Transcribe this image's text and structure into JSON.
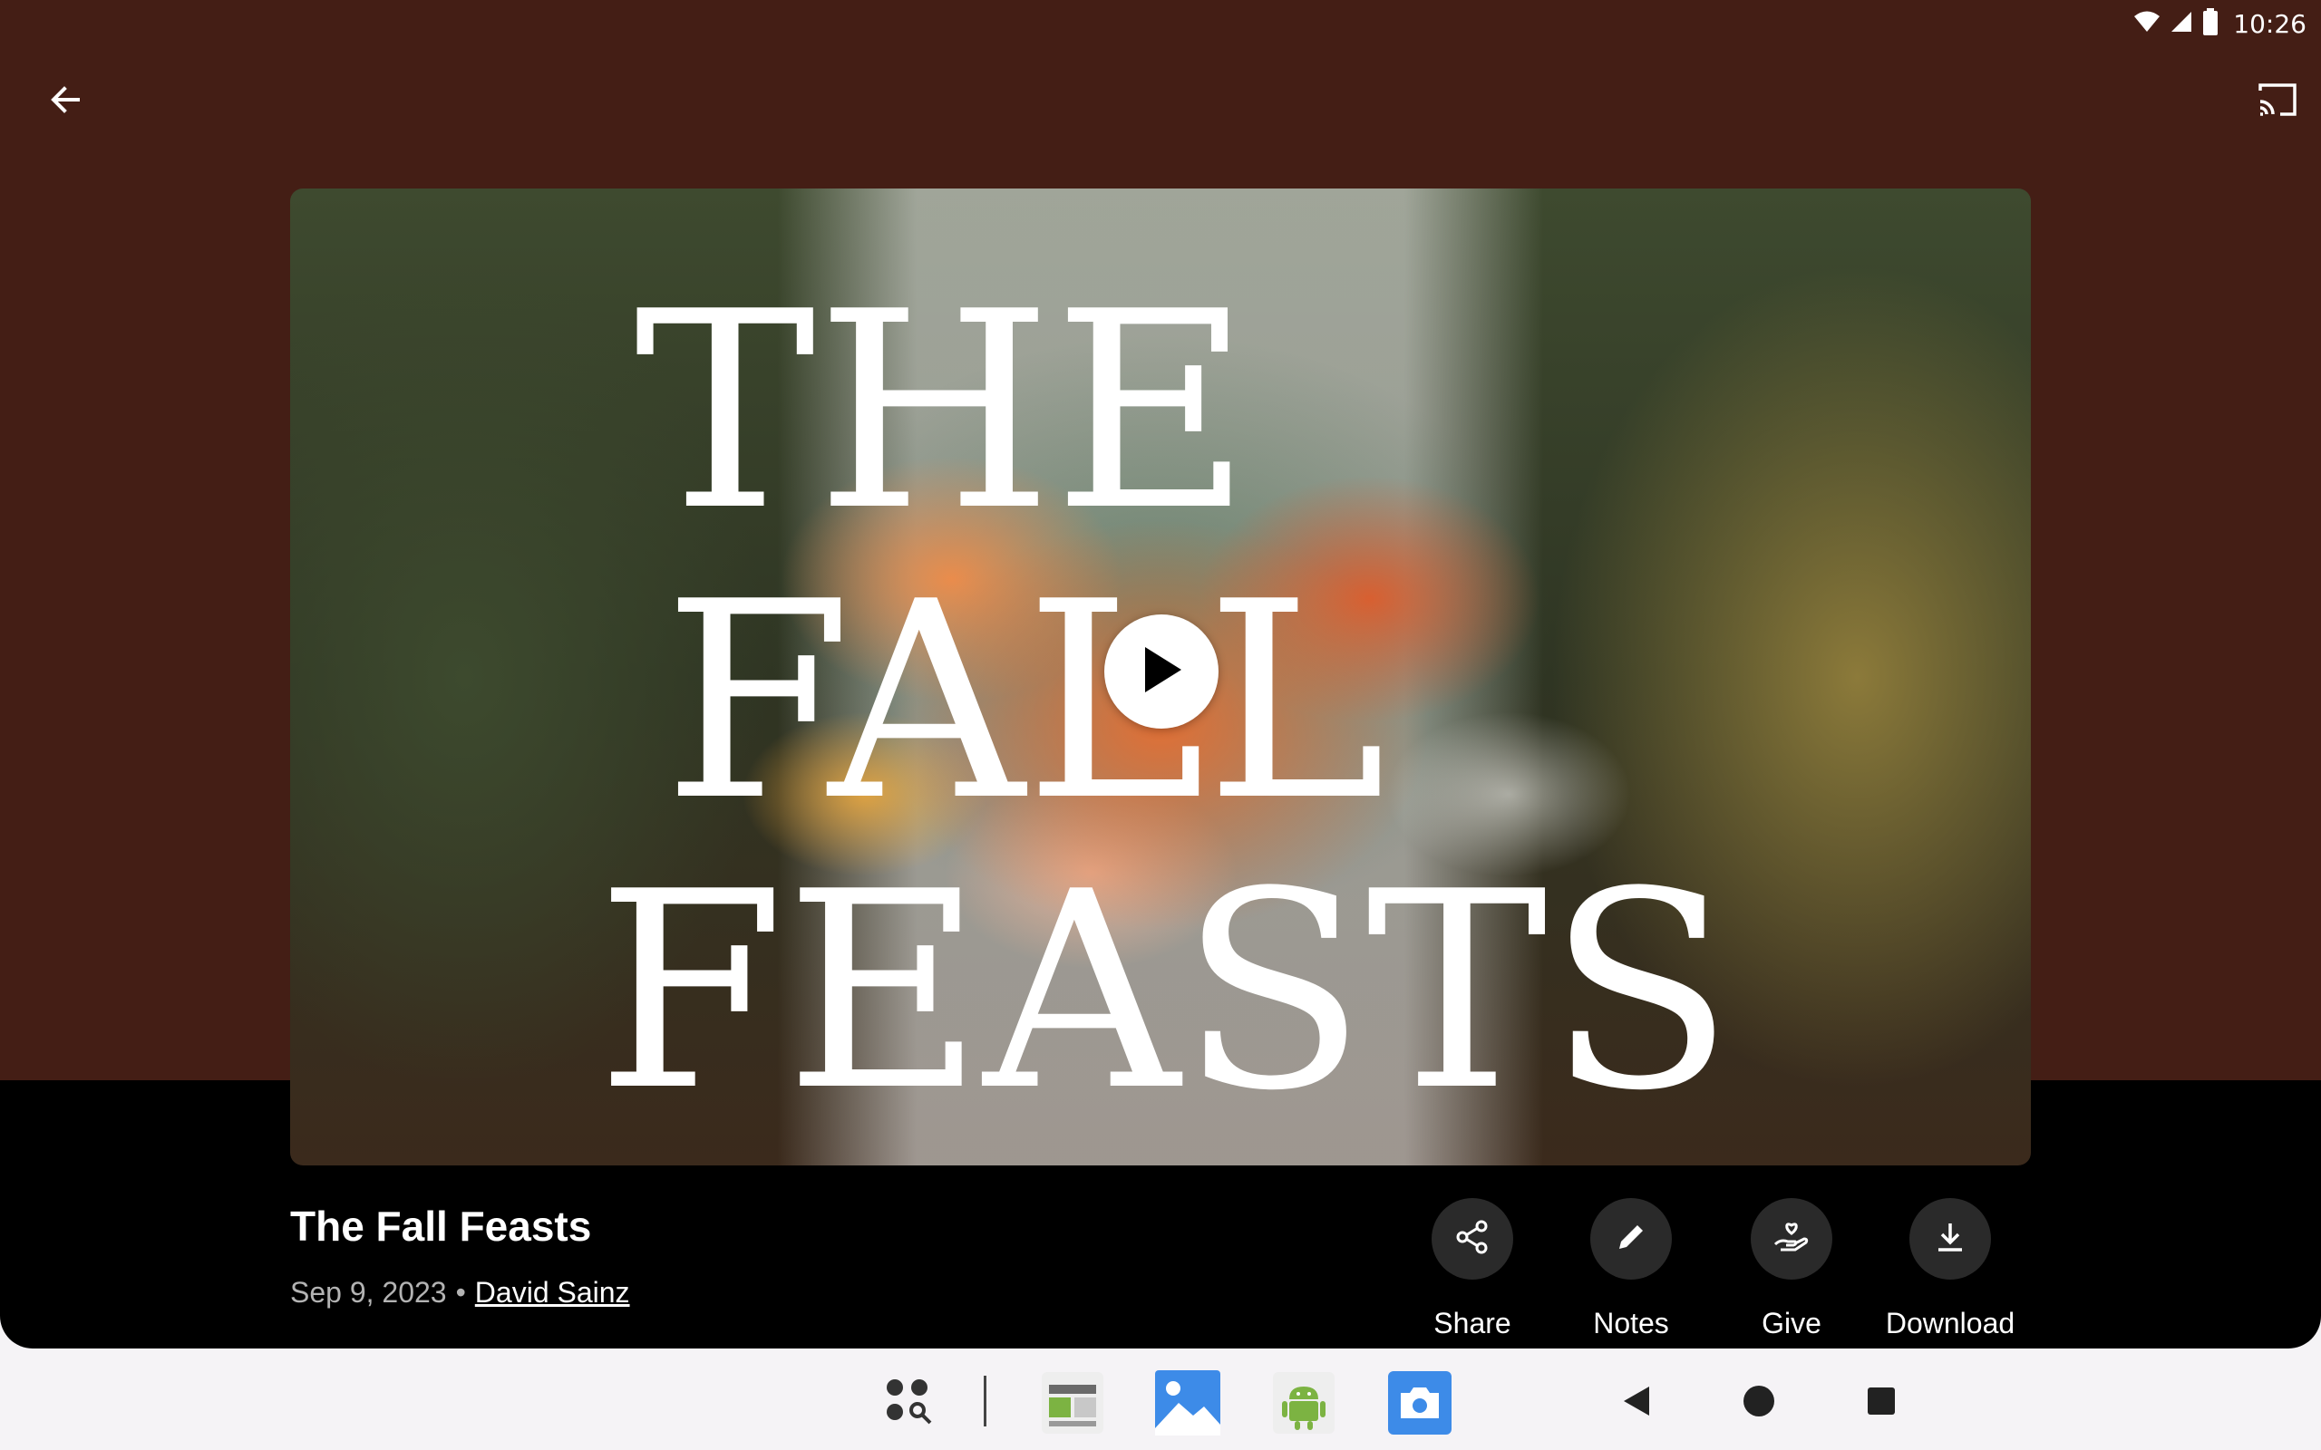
{
  "status_bar": {
    "time": "10:26"
  },
  "video": {
    "title": "The Fall Feasts",
    "date": "Sep 9, 2023",
    "separator": "•",
    "author": "David Sainz",
    "thumbnail_title_lines": [
      "THE",
      "FALL",
      "FEASTS"
    ]
  },
  "actions": [
    {
      "label": "Share",
      "icon": "share-icon"
    },
    {
      "label": "Notes",
      "icon": "pencil-icon"
    },
    {
      "label": "Give",
      "icon": "give-hand-heart-icon"
    },
    {
      "label": "Download",
      "icon": "download-icon"
    }
  ],
  "taskbar": {
    "apps": [
      "app-launcher-search-icon",
      "sheets-app-icon",
      "gallery-app-icon",
      "android-app-icon",
      "camera-app-icon"
    ],
    "nav": [
      "back-nav-icon",
      "home-nav-icon",
      "recents-nav-icon"
    ]
  },
  "colors": {
    "hero_background": "#441e15",
    "page_background": "#000000",
    "action_circle": "#2a2a2a",
    "taskbar_background": "#f5f3f6"
  }
}
